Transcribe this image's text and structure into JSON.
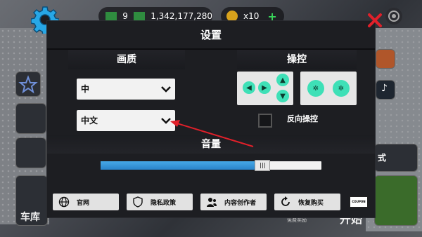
{
  "hud": {
    "gem_count": "9",
    "money": "1,342,177,280",
    "token_count": "x10",
    "plus": "+"
  },
  "dialog": {
    "title": "设置",
    "quality_title": "画质",
    "controls_title": "操控",
    "quality_value": "中",
    "language_value": "中文",
    "reverse_label": "反向操控",
    "volume_title": "音量",
    "volume_level": 0.71
  },
  "footer": {
    "website": "官网",
    "privacy": "隐私政策",
    "creators": "内容创作者",
    "restore": "恢复购买",
    "coupon": "COUPON"
  },
  "background": {
    "right_text": "式",
    "bottom_left_text": "车库",
    "bottom_right_text": "开始",
    "free_reward": "免费奖励"
  },
  "colors": {
    "accent_green": "#3ee0b7",
    "volume_fill": "#2a83c9",
    "arrow_red": "#e0202a"
  }
}
